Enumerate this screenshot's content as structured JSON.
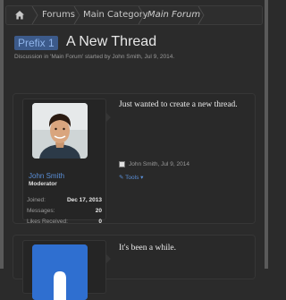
{
  "breadcrumb": {
    "items": [
      "Forums",
      "Main Category",
      "Main Forum"
    ]
  },
  "thread": {
    "prefix": "Prefix 1",
    "title": "A New Thread",
    "subtitle": "Discussion in 'Main Forum' started by John Smith, Jul 9, 2014."
  },
  "posts": [
    {
      "user": {
        "name": "John Smith",
        "role": "Moderator",
        "stats": [
          {
            "label": "Joined:",
            "value": "Dec 17, 2013"
          },
          {
            "label": "Messages:",
            "value": "20"
          },
          {
            "label": "Likes Received:",
            "value": "0"
          }
        ]
      },
      "message": "Just wanted to create a new thread.",
      "meta": "John Smith, Jul 9, 2014",
      "tools_label": "Tools"
    },
    {
      "message": "It's been a while."
    }
  ],
  "colors": {
    "background": "#2b2b2b",
    "accent": "#5a8fd8",
    "prefix_bg": "#3c5a8a",
    "avatar_placeholder": "#2f6fd0"
  }
}
